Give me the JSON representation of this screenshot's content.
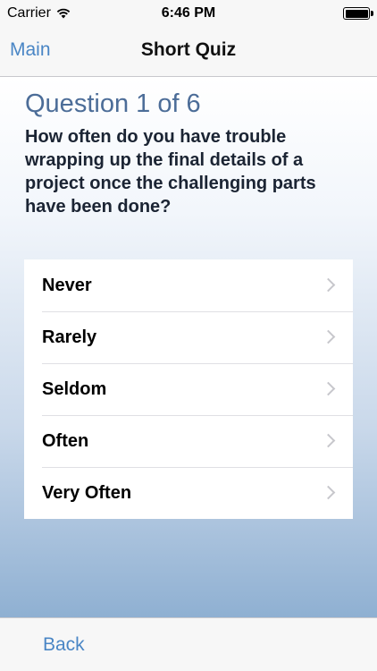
{
  "status_bar": {
    "carrier": "Carrier",
    "time": "6:46 PM",
    "wifi_icon": "wifi-icon",
    "battery_icon": "battery-icon",
    "battery_level": 1.0
  },
  "nav": {
    "back_label": "Main",
    "title": "Short Quiz"
  },
  "question": {
    "number_label": "Question 1 of 6",
    "text": "How often do you have trouble wrapping up the final details of a project once the challenging parts have been done?"
  },
  "answers": [
    {
      "label": "Never",
      "icon": "chevron-right-icon"
    },
    {
      "label": "Rarely",
      "icon": "chevron-right-icon"
    },
    {
      "label": "Seldom",
      "icon": "chevron-right-icon"
    },
    {
      "label": "Often",
      "icon": "chevron-right-icon"
    },
    {
      "label": "Very Often",
      "icon": "chevron-right-icon"
    }
  ],
  "toolbar": {
    "back_label": "Back"
  },
  "colors": {
    "accent": "#4a86c5",
    "question_number": "#4c6d98",
    "question_text": "#1b2433",
    "bar_background": "#f7f7f7",
    "gradient_bottom": "#8fb0d2"
  }
}
